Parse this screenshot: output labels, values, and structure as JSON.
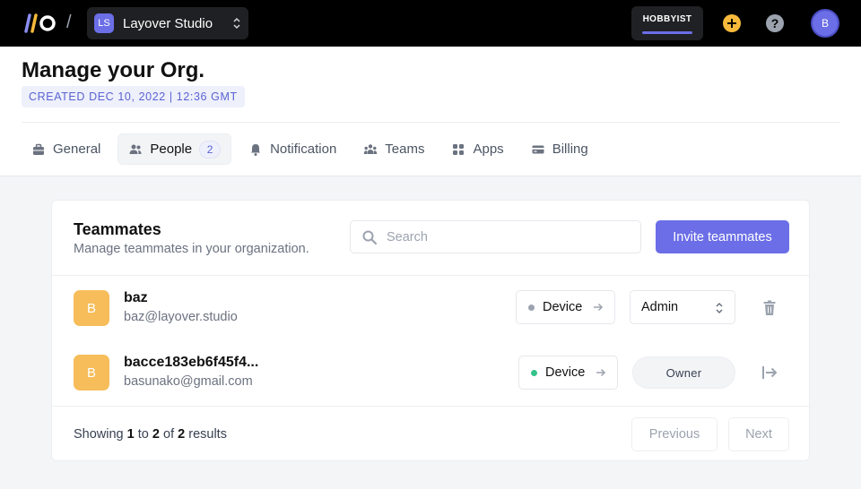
{
  "topbar": {
    "org_badge": "LS",
    "org_name": "Layover Studio",
    "plan_label": "HOBBYIST",
    "plan_usage_fraction": 1.0,
    "avatar_initial": "B",
    "help_glyph": "?"
  },
  "header": {
    "title": "Manage your Org.",
    "created": "CREATED DEC 10, 2022 | 12:36 GMT"
  },
  "tabs": [
    {
      "label": "General",
      "icon": "briefcase-icon"
    },
    {
      "label": "People",
      "icon": "users-icon",
      "count": "2",
      "active": true
    },
    {
      "label": "Notification",
      "icon": "bell-icon"
    },
    {
      "label": "Teams",
      "icon": "team-icon"
    },
    {
      "label": "Apps",
      "icon": "grid-icon"
    },
    {
      "label": "Billing",
      "icon": "credit-card-icon"
    }
  ],
  "teammates": {
    "title": "Teammates",
    "subtitle": "Manage teammates in your organization.",
    "search_placeholder": "Search",
    "invite_label": "Invite teammates",
    "members": [
      {
        "initial": "B",
        "name": "baz",
        "email": "baz@layover.studio",
        "device_label": "Device",
        "device_status_color": "#9ca3af",
        "role": "Admin",
        "action_icon": "trash-icon"
      },
      {
        "initial": "B",
        "name": "bacce183eb6f45f4...",
        "email": "basunako@gmail.com",
        "device_label": "Device",
        "device_status_color": "#34c28a",
        "role": "Owner",
        "action_icon": "leave-icon"
      }
    ],
    "pagination": {
      "showing": "Showing",
      "from": "1",
      "to_word": "to",
      "to": "2",
      "of_word": "of",
      "total": "2",
      "results_word": "results",
      "previous": "Previous",
      "next": "Next"
    }
  },
  "colors": {
    "accent": "#6b6ee6",
    "avatar": "#f6bd5a",
    "topbar": "#000000"
  }
}
